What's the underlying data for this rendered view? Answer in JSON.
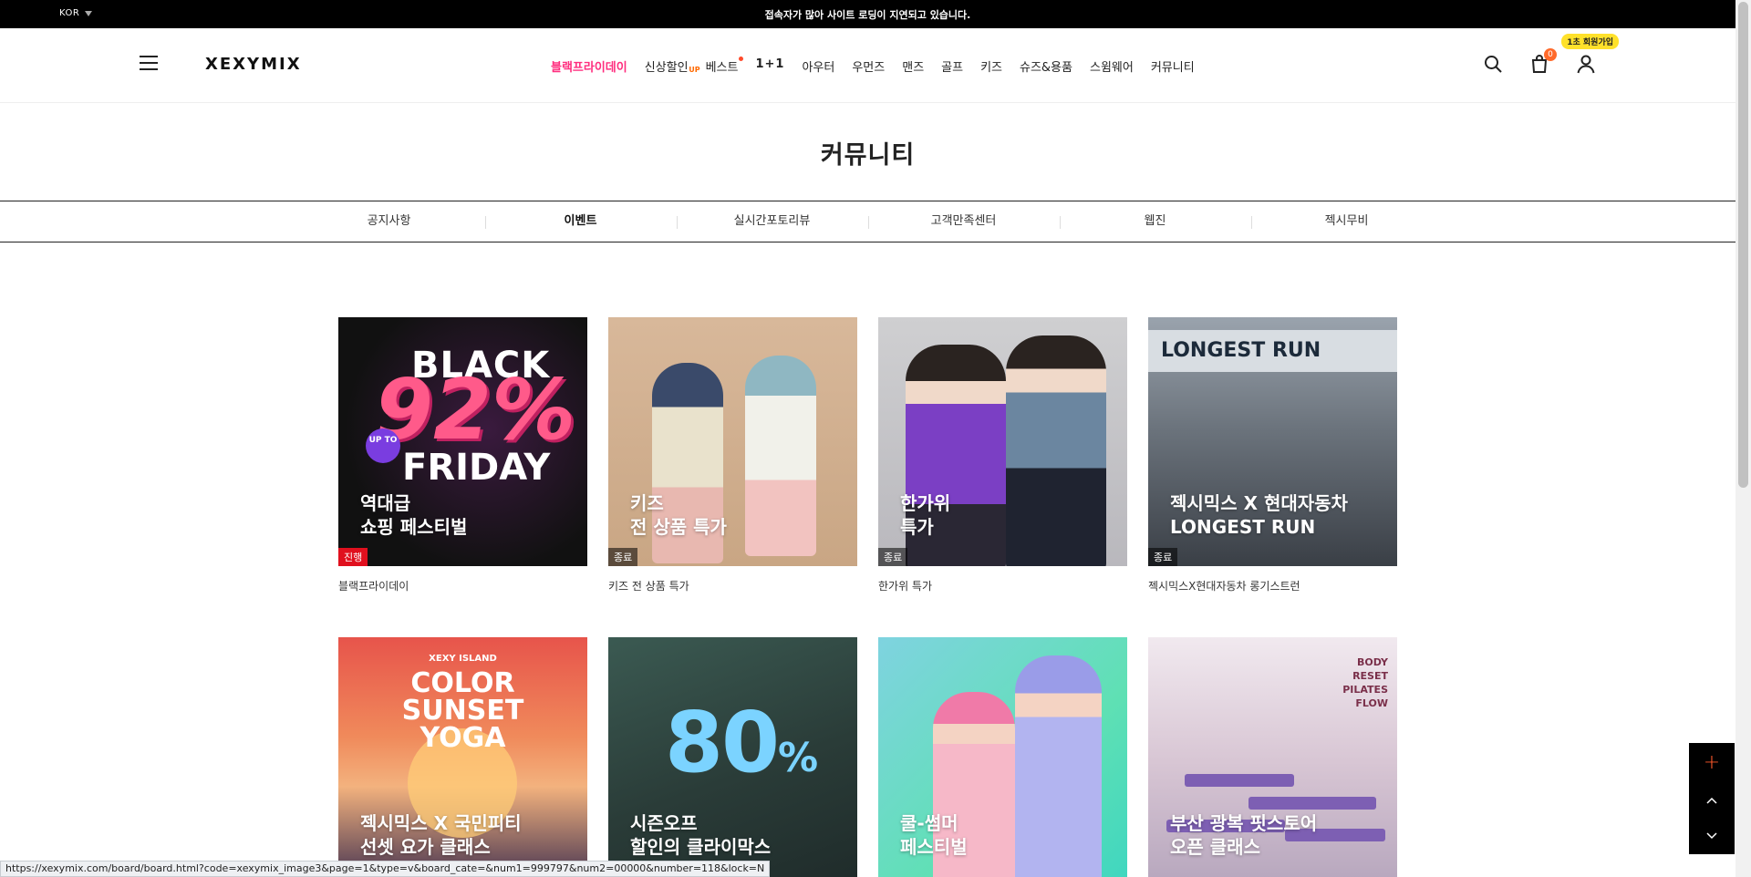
{
  "notice": {
    "language": "KOR",
    "message": "접속자가 많아 사이트 로딩이 지연되고 있습니다."
  },
  "header": {
    "logo": "XEXYMIX",
    "nav": [
      {
        "label": "블랙프라이데이",
        "style": "hot"
      },
      {
        "label": "신상할인",
        "badge": "UP"
      },
      {
        "label": "베스트",
        "dot": true
      },
      {
        "label": "1+1",
        "style": "bold"
      },
      {
        "label": "아우터"
      },
      {
        "label": "우먼즈"
      },
      {
        "label": "맨즈"
      },
      {
        "label": "골프"
      },
      {
        "label": "키즈"
      },
      {
        "label": "슈즈&용품"
      },
      {
        "label": "스윔웨어"
      },
      {
        "label": "커뮤니티"
      }
    ],
    "cart_count": "0",
    "join_badge": "1초 회원가입",
    "accent_color": "#ff2d7e"
  },
  "page_title": "커뮤니티",
  "tabs": [
    "공지사항",
    "이벤트",
    "실시간포토리뷰",
    "고객만족센터",
    "웹진",
    "젝시무비"
  ],
  "active_tab": "이벤트",
  "events": [
    {
      "art": "bg1",
      "caption": "역대급\n쇼핑 페스티벌",
      "status": "진행",
      "live": true,
      "name": "블랙프라이데이",
      "art_text": [
        "BLACK",
        "92%",
        "FRIDAY",
        "UP TO"
      ]
    },
    {
      "art": "bg2",
      "caption": "키즈\n전 상품 특가",
      "status": "종료",
      "live": false,
      "name": "키즈 전 상품 특가"
    },
    {
      "art": "bg3",
      "caption": "한가위\n특가",
      "status": "종료",
      "live": false,
      "name": "한가위 특가"
    },
    {
      "art": "bg4",
      "caption": "젝시믹스 X 현대자동차\nLONGEST RUN",
      "status": "종료",
      "live": false,
      "name": "젝시믹스X현대자동차 롱기스트런",
      "art_text": [
        "LONGEST RUN"
      ]
    },
    {
      "art": "bg5",
      "caption": "젝시믹스 X 국민피티\n선셋 요가 클래스",
      "status": "",
      "live": false,
      "name": "",
      "art_text": [
        "XEXY ISLAND",
        "COLOR SUNSET YOGA"
      ]
    },
    {
      "art": "bg6",
      "caption": "시즌오프\n할인의 클라이막스",
      "status": "",
      "live": false,
      "name": "",
      "art_text": [
        "80",
        "%"
      ]
    },
    {
      "art": "bg7",
      "caption": "쿨-썸머\n페스티벌",
      "status": "",
      "live": false,
      "name": ""
    },
    {
      "art": "bg8",
      "caption": "부산 광복 핏스토어\n오픈 클래스",
      "status": "",
      "live": false,
      "name": "",
      "art_text": [
        "BODY RESET PILATES FLOW"
      ]
    }
  ],
  "status_url": "https://xexymix.com/board/board.html?code=xexymix_image3&page=1&type=v&board_cate=&num1=999797&num2=00000&number=118&lock=N"
}
